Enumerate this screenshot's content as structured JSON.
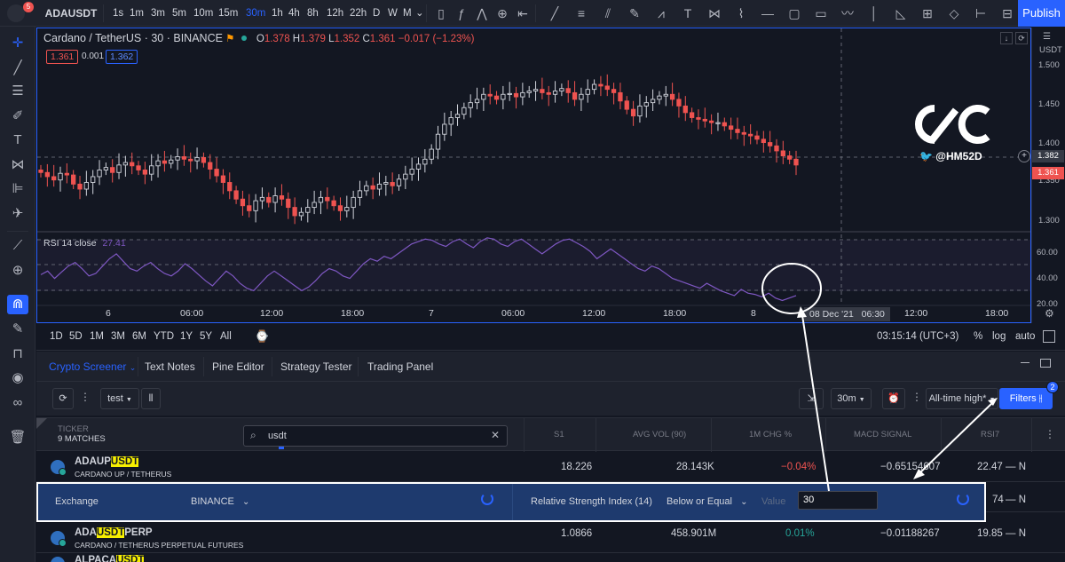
{
  "topbar": {
    "notifications": "5",
    "symbol": "ADAUSDT",
    "timeframes": [
      "1s",
      "1m",
      "3m",
      "5m",
      "10m",
      "15m",
      "30m",
      "1h",
      "4h",
      "8h",
      "12h",
      "22h",
      "D",
      "W",
      "M"
    ],
    "active_timeframe": "30m",
    "publish_label": "Publish"
  },
  "chart": {
    "title": "Cardano / TetherUS · 30 · BINANCE",
    "ohlc": {
      "o_key": "O",
      "o": "1.378",
      "h_key": "H",
      "h": "1.379",
      "l_key": "L",
      "l": "1.352",
      "c_key": "C",
      "c": "1.361",
      "change": "−0.017 (−1.23%)"
    },
    "sell_price": "1.361",
    "spread": "0.001",
    "buy_price": "1.362",
    "currency": "USDT",
    "price_ticks": [
      "1.500",
      "1.450",
      "1.400",
      "1.350",
      "1.300"
    ],
    "crosshair_price": "1.382",
    "last_price": "1.361",
    "rsi_legend": "RSI 14 close",
    "rsi_value": "27.41",
    "rsi_ticks": [
      "60.00",
      "40.00",
      "20.00"
    ],
    "time_ticks": [
      "6",
      "06:00",
      "12:00",
      "18:00",
      "7",
      "06:00",
      "12:00",
      "18:00",
      "8",
      "12:00",
      "18:00"
    ],
    "crosshair_time": "08 Dec '21   06:30",
    "watermark_handle": "@HM52D",
    "colors": {
      "up": "#d1d4dc",
      "down": "#ef5350",
      "rsi": "#7e57c2",
      "accent": "#2962ff"
    }
  },
  "rangebar": {
    "ranges": [
      "1D",
      "5D",
      "1M",
      "3M",
      "6M",
      "YTD",
      "1Y",
      "5Y",
      "All"
    ],
    "clock": "03:15:14 (UTC+3)",
    "percent": "%",
    "log": "log",
    "auto": "auto"
  },
  "panel": {
    "tabs": [
      "Crypto Screener",
      "Text Notes",
      "Pine Editor",
      "Strategy Tester",
      "Trading Panel"
    ],
    "active_tab": "Crypto Screener"
  },
  "screener": {
    "watchlist": "test",
    "interval": "30m",
    "column_set": "All-time high*",
    "filters_label": "Filters",
    "filters_count": "2",
    "ticker_header": "TICKER",
    "matches": "9 MATCHES",
    "search_value": "usdt",
    "columns": [
      "S1",
      "AVG VOL (90)",
      "1M CHG %",
      "MACD SIGNAL",
      "RSI7"
    ],
    "rows": [
      {
        "name_pre": "ADAUP",
        "name_hl": "USDT",
        "name_post": "",
        "desc": "CARDANO UP / TETHERUS",
        "s1": "18.226",
        "avgvol": "28.143K",
        "chg": "−0.04%",
        "chg_dir": "down",
        "macd": "−0.65154607",
        "rsi7": "22.47",
        "rating": "— N"
      },
      {
        "name_pre": "ADA",
        "name_hl": "USDT",
        "name_post": "PERP",
        "desc": "CARDANO / TETHERUS PERPETUAL FUTURES",
        "s1": "1.0866",
        "avgvol": "458.901M",
        "chg": "0.01%",
        "chg_dir": "up",
        "macd": "−0.01188267",
        "rsi7": "19.85",
        "rating": "— N"
      },
      {
        "name_pre": "ALPACA",
        "name_hl": "USDT",
        "name_post": "",
        "desc": "",
        "s1": "",
        "avgvol": "",
        "chg": "",
        "chg_dir": "",
        "macd": "",
        "rsi7": "",
        "rating": ""
      }
    ],
    "hidden_row_rsi": "74",
    "hidden_row_rating": "— N",
    "filter_row": {
      "field": "Exchange",
      "exchange_value": "BINANCE",
      "indicator": "Relative Strength Index (14)",
      "condition": "Below or Equal",
      "value_label": "Value",
      "value": "30"
    }
  }
}
